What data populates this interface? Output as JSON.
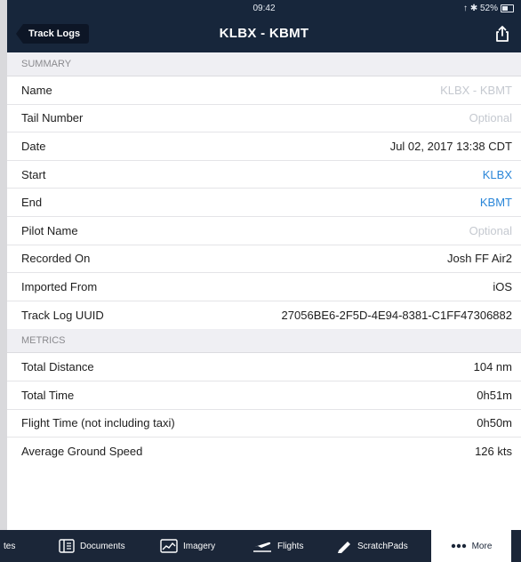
{
  "status_bar": {
    "time": "09:42",
    "indicators": "↑ ✱ 52%"
  },
  "nav": {
    "back_label": "Track Logs",
    "title": "KLBX - KBMT",
    "share_icon": "share-icon"
  },
  "summary": {
    "header": "SUMMARY",
    "rows": [
      {
        "label": "Name",
        "value": "KLBX - KBMT"
      },
      {
        "label": "Tail Number",
        "value": "Optional"
      },
      {
        "label": "Date",
        "value": "Jul 02, 2017 13:38 CDT"
      },
      {
        "label": "Start",
        "value": "KLBX"
      },
      {
        "label": "End",
        "value": "KBMT"
      },
      {
        "label": "Pilot Name",
        "value": "Optional"
      },
      {
        "label": "Recorded On",
        "value": "Josh FF Air2"
      },
      {
        "label": "Imported From",
        "value": "iOS"
      },
      {
        "label": "Track Log UUID",
        "value": "27056BE6-2F5D-4E94-8381-C1FF47306882"
      }
    ]
  },
  "metrics": {
    "header": "METRICS",
    "rows": [
      {
        "label": "Total Distance",
        "value": "104 nm"
      },
      {
        "label": "Total Time",
        "value": "0h51m"
      },
      {
        "label": "Flight Time (not including taxi)",
        "value": "0h50m"
      },
      {
        "label": "Average Ground Speed",
        "value": "126 kts"
      }
    ]
  },
  "tabs": [
    {
      "label": "tes",
      "icon": ""
    },
    {
      "label": "Documents",
      "icon": "documents-icon"
    },
    {
      "label": "Imagery",
      "icon": "imagery-icon"
    },
    {
      "label": "Flights",
      "icon": "flights-icon"
    },
    {
      "label": "ScratchPads",
      "icon": "scratchpads-icon"
    },
    {
      "label": "More",
      "icon": "more-icon",
      "active": true
    }
  ],
  "colors": {
    "nav_bg": "#17263b",
    "link": "#2a86d8",
    "placeholder": "#c5c9d0",
    "tab_bg": "#1b2638"
  }
}
